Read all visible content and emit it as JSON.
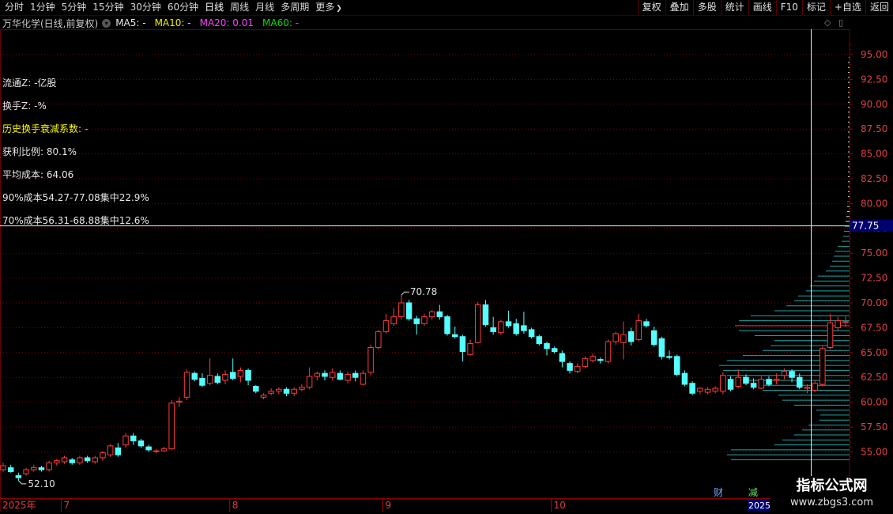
{
  "toolbar": {
    "periods": [
      "分时",
      "1分钟",
      "5分钟",
      "15分钟",
      "30分钟",
      "60分钟",
      "日线",
      "周线",
      "月线",
      "多周期",
      "更多"
    ],
    "active_period": "日线",
    "more_arrow": "❯",
    "buttons": [
      "复权",
      "叠加",
      "多股",
      "统计",
      "画线",
      "F10",
      "标记",
      "+自选",
      "返回"
    ]
  },
  "title": {
    "stock": "万华化学(日线,前复权)",
    "dropdown_icon": "chevron-down-icon",
    "ma": [
      {
        "label": "MA5: -",
        "color": "#e8e8e8"
      },
      {
        "label": "MA10: -",
        "color": "#f0f000"
      },
      {
        "label": "MA20: 0.01",
        "color": "#ff40ff"
      },
      {
        "label": "MA60: -",
        "color": "#00e000"
      }
    ]
  },
  "corner_icons": [
    "◇",
    "▯"
  ],
  "info": [
    {
      "text": "流通Z: -亿股",
      "color": "#e8e8e8"
    },
    {
      "text": "换手Z: -%",
      "color": "#e8e8e8"
    },
    {
      "text": "历史换手衰减系数: -",
      "color": "#ffff00"
    },
    {
      "text": "获利比例: 80.1%",
      "color": "#e8e8e8"
    },
    {
      "text": "平均成本: 64.06",
      "color": "#e8e8e8"
    },
    {
      "text": "90%成本54.27-77.08集中22.9%",
      "color": "#e8e8e8"
    },
    {
      "text": "70%成本56.31-68.88集中12.6%",
      "color": "#e8e8e8"
    }
  ],
  "price_axis": {
    "ticks": [
      "95.00",
      "92.50",
      "90.00",
      "87.50",
      "85.00",
      "82.50",
      "80.00",
      "77.50",
      "75.00",
      "72.50",
      "70.00",
      "67.50",
      "65.00",
      "62.50",
      "60.00",
      "57.50",
      "55.00"
    ],
    "cursor_label": "77.75"
  },
  "chart_data": {
    "type": "candlestick",
    "ylim": [
      53.3,
      97.0
    ],
    "candles": [
      [
        53.2,
        53.6,
        53.0,
        53.9
      ],
      [
        53.4,
        53.0,
        52.9,
        53.7
      ],
      [
        52.6,
        52.4,
        52.1,
        52.9
      ],
      [
        52.8,
        53.2,
        52.6,
        53.4
      ],
      [
        53.2,
        53.4,
        53.0,
        53.7
      ],
      [
        53.4,
        53.2,
        53.0,
        53.6
      ],
      [
        53.2,
        53.9,
        53.0,
        54.1
      ],
      [
        53.9,
        54.1,
        53.6,
        54.3
      ],
      [
        54.0,
        54.4,
        53.8,
        54.6
      ],
      [
        54.2,
        53.9,
        53.7,
        54.4
      ],
      [
        53.9,
        54.4,
        53.7,
        54.6
      ],
      [
        54.4,
        54.1,
        53.9,
        54.6
      ],
      [
        54.0,
        54.4,
        53.8,
        54.6
      ],
      [
        54.4,
        54.9,
        54.1,
        55.1
      ],
      [
        54.7,
        55.6,
        54.5,
        55.8
      ],
      [
        55.4,
        54.7,
        54.5,
        55.9
      ],
      [
        55.7,
        56.6,
        55.4,
        56.9
      ],
      [
        56.6,
        56.1,
        55.7,
        56.9
      ],
      [
        56.1,
        55.6,
        55.4,
        56.3
      ],
      [
        55.5,
        55.2,
        55.0,
        55.7
      ],
      [
        55.1,
        55.1,
        54.9,
        55.3
      ],
      [
        55.1,
        55.3,
        55.0,
        55.5
      ],
      [
        55.3,
        59.9,
        55.2,
        60.2
      ],
      [
        60.0,
        60.1,
        59.5,
        60.5
      ],
      [
        60.5,
        63.0,
        60.2,
        63.3
      ],
      [
        62.9,
        62.3,
        62.1,
        63.1
      ],
      [
        62.4,
        61.7,
        61.5,
        62.9
      ],
      [
        61.9,
        62.7,
        61.7,
        64.4
      ],
      [
        62.6,
        62.0,
        61.8,
        62.9
      ],
      [
        62.2,
        62.8,
        61.8,
        63.2
      ],
      [
        63.0,
        62.4,
        62.2,
        64.4
      ],
      [
        62.6,
        63.2,
        62.0,
        63.5
      ],
      [
        63.2,
        62.2,
        61.7,
        63.4
      ],
      [
        61.6,
        61.1,
        60.9,
        61.7
      ],
      [
        60.5,
        60.7,
        60.3,
        60.9
      ],
      [
        60.9,
        61.1,
        60.7,
        61.4
      ],
      [
        61.1,
        61.3,
        60.8,
        61.5
      ],
      [
        61.3,
        60.9,
        60.6,
        61.5
      ],
      [
        60.9,
        61.3,
        60.6,
        61.5
      ],
      [
        61.3,
        61.5,
        61.1,
        61.8
      ],
      [
        61.5,
        62.6,
        61.3,
        63.5
      ],
      [
        62.6,
        62.9,
        62.2,
        63.1
      ],
      [
        62.9,
        62.6,
        62.2,
        63.2
      ],
      [
        62.5,
        63.0,
        62.2,
        63.4
      ],
      [
        62.9,
        62.3,
        62.2,
        63.2
      ],
      [
        62.2,
        62.8,
        61.9,
        63.1
      ],
      [
        62.9,
        62.5,
        62.1,
        63.2
      ],
      [
        61.8,
        62.9,
        61.7,
        63.2
      ],
      [
        63.0,
        65.5,
        62.7,
        65.8
      ],
      [
        65.5,
        67.1,
        65.3,
        67.3
      ],
      [
        67.1,
        68.2,
        66.9,
        68.9
      ],
      [
        67.9,
        68.6,
        67.7,
        69.5
      ],
      [
        68.6,
        70.0,
        68.3,
        70.8
      ],
      [
        70.0,
        68.4,
        68.2,
        70.3
      ],
      [
        68.4,
        67.9,
        66.8,
        68.7
      ],
      [
        67.9,
        68.6,
        67.7,
        68.9
      ],
      [
        68.6,
        69.1,
        68.3,
        69.3
      ],
      [
        69.1,
        68.6,
        68.3,
        69.8
      ],
      [
        68.6,
        66.9,
        66.7,
        68.8
      ],
      [
        66.8,
        66.6,
        66.4,
        67.6
      ],
      [
        66.6,
        65.1,
        64.1,
        66.8
      ],
      [
        64.8,
        65.9,
        64.7,
        66.3
      ],
      [
        66.0,
        69.8,
        65.9,
        70.1
      ],
      [
        69.8,
        67.8,
        67.6,
        70.3
      ],
      [
        67.5,
        67.1,
        66.8,
        68.6
      ],
      [
        67.0,
        68.1,
        66.8,
        68.3
      ],
      [
        68.1,
        67.7,
        67.5,
        69.2
      ],
      [
        67.9,
        66.9,
        66.7,
        68.4
      ],
      [
        67.7,
        67.2,
        66.9,
        69.1
      ],
      [
        67.3,
        66.6,
        66.4,
        67.5
      ],
      [
        66.6,
        65.9,
        65.7,
        66.8
      ],
      [
        65.9,
        65.4,
        64.7,
        66.1
      ],
      [
        65.4,
        65.1,
        64.9,
        65.6
      ],
      [
        64.9,
        64.1,
        63.5,
        65.2
      ],
      [
        63.9,
        63.2,
        62.9,
        64.1
      ],
      [
        63.1,
        63.6,
        62.9,
        63.9
      ],
      [
        63.6,
        64.4,
        63.4,
        64.6
      ],
      [
        64.2,
        64.6,
        64.0,
        64.9
      ],
      [
        64.3,
        64.2,
        63.9,
        64.5
      ],
      [
        64.1,
        66.1,
        63.9,
        66.3
      ],
      [
        66.1,
        66.9,
        65.8,
        67.1
      ],
      [
        66.0,
        66.8,
        64.3,
        68.1
      ],
      [
        67.1,
        66.1,
        65.7,
        67.5
      ],
      [
        66.3,
        68.2,
        66.1,
        68.9
      ],
      [
        68.1,
        67.7,
        67.5,
        68.4
      ],
      [
        67.2,
        65.8,
        65.6,
        67.6
      ],
      [
        66.4,
        64.6,
        64.3,
        66.6
      ],
      [
        64.6,
        64.5,
        64.3,
        65.2
      ],
      [
        64.6,
        62.8,
        62.6,
        64.8
      ],
      [
        62.9,
        61.8,
        61.6,
        63.2
      ],
      [
        61.9,
        60.9,
        60.7,
        62.1
      ],
      [
        61.1,
        61.4,
        60.8,
        61.5
      ],
      [
        61.0,
        61.3,
        60.8,
        61.5
      ],
      [
        61.1,
        61.4,
        60.9,
        61.6
      ],
      [
        61.1,
        62.7,
        60.8,
        63.0
      ],
      [
        62.3,
        61.3,
        61.1,
        62.6
      ],
      [
        61.6,
        62.5,
        61.4,
        63.3
      ],
      [
        62.5,
        61.9,
        61.7,
        62.8
      ],
      [
        61.9,
        61.5,
        61.3,
        62.4
      ],
      [
        61.4,
        62.3,
        61.3,
        62.6
      ],
      [
        62.3,
        61.8,
        61.6,
        62.6
      ],
      [
        62.2,
        62.3,
        61.8,
        62.9
      ],
      [
        62.7,
        63.1,
        62.3,
        63.4
      ],
      [
        63.1,
        62.5,
        62.0,
        63.3
      ],
      [
        62.5,
        61.5,
        61.3,
        62.9
      ],
      [
        61.4,
        61.5,
        60.9,
        61.8
      ],
      [
        61.2,
        61.9,
        61.0,
        62.2
      ],
      [
        61.8,
        65.4,
        61.6,
        65.6
      ],
      [
        65.5,
        68.0,
        65.3,
        68.9
      ],
      [
        67.5,
        68.2,
        67.2,
        68.6
      ],
      [
        68.0,
        68.1,
        67.6,
        68.6
      ]
    ],
    "cursor_price": 77.75,
    "annotations": [
      {
        "text": "70.78",
        "candle": 52,
        "price": 70.78,
        "kind": "high"
      },
      {
        "text": "52.10",
        "candle": 2,
        "price": 52.1,
        "kind": "low"
      }
    ],
    "cost_distribution": {
      "bins_low": 54.2,
      "bin_step": 0.5,
      "lengths": [
        150,
        155,
        150,
        95,
        85,
        70,
        60,
        52,
        38,
        37,
        42,
        70,
        85,
        90,
        110,
        115,
        130,
        155,
        160,
        165,
        155,
        135,
        110,
        100,
        95,
        120,
        140,
        145,
        140,
        125,
        95,
        80,
        70,
        65,
        55,
        50,
        45,
        40,
        30,
        25,
        22,
        20,
        18,
        15,
        10,
        8,
        7,
        6,
        5,
        4,
        3,
        3,
        3,
        2,
        2,
        2,
        2,
        2,
        2,
        2,
        2,
        2,
        2,
        2,
        2,
        2,
        2,
        2,
        2,
        2,
        2,
        2,
        2,
        2,
        2,
        2,
        2,
        2,
        2,
        2,
        2,
        1
      ]
    },
    "dates": [
      {
        "label": "2025年",
        "candle": 0
      },
      {
        "label": "7",
        "candle": 8
      },
      {
        "label": "8",
        "candle": 30
      },
      {
        "label": "9",
        "candle": 50
      },
      {
        "label": "10",
        "candle": 72
      }
    ],
    "partial_date_label": "2025",
    "colors": {
      "up": "#ff3b3b",
      "down": "#54ffff",
      "grid": "#8a0000",
      "cost": "#1ea6a6",
      "cost_high": "#e0e0e0",
      "cost_mid": "#ff3030"
    }
  },
  "bottom_badges": [
    {
      "text": "财",
      "color": "#6fa8ff"
    },
    {
      "text": "减",
      "color": "#60e060"
    }
  ],
  "watermark": {
    "line1": "指标公式网",
    "line2": "www.zbgs3.com"
  }
}
